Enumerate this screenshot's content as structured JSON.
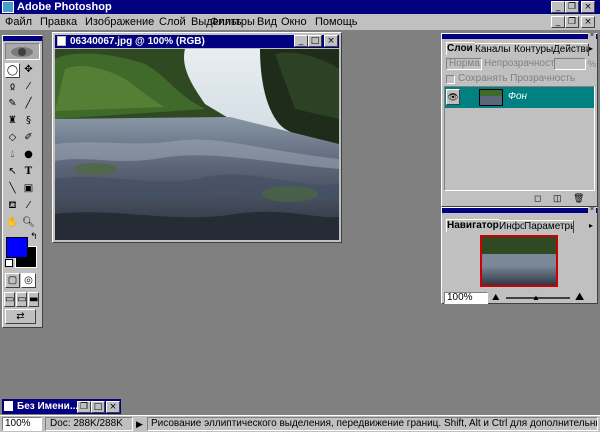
{
  "app": {
    "title": "Adobe Photoshop"
  },
  "menu": {
    "items": [
      "Файл",
      "Правка",
      "Изображение",
      "Слой",
      "Выделить",
      "Фильтры",
      "Вид",
      "Окно",
      "Помощь"
    ]
  },
  "document": {
    "title": "06340067.jpg @ 100% (RGB)"
  },
  "layers_panel": {
    "tabs": [
      "Слои",
      "Каналы",
      "Контуры",
      "Действия"
    ],
    "blend_mode": "Норма",
    "opacity_label": "Непрозрачность:",
    "opacity_unit": "%",
    "preserve_transparency": "Сохранять Прозрачность",
    "layer_name": "Фон"
  },
  "navigator_panel": {
    "tabs": [
      "Навигатор",
      "Инфо",
      "Параметры"
    ],
    "zoom": "100%"
  },
  "minimized": {
    "title": "Без Имени..."
  },
  "status": {
    "zoom": "100%",
    "doc": "Doc: 288K/288K",
    "message": "Рисование эллиптического выделения, передвижение границ. Shift, Alt и Ctrl для дополнительных параметров."
  },
  "colors": {
    "foreground": "#0000ff",
    "background": "#000000",
    "titlebar": "#000080",
    "panel_tab": "#008080"
  }
}
